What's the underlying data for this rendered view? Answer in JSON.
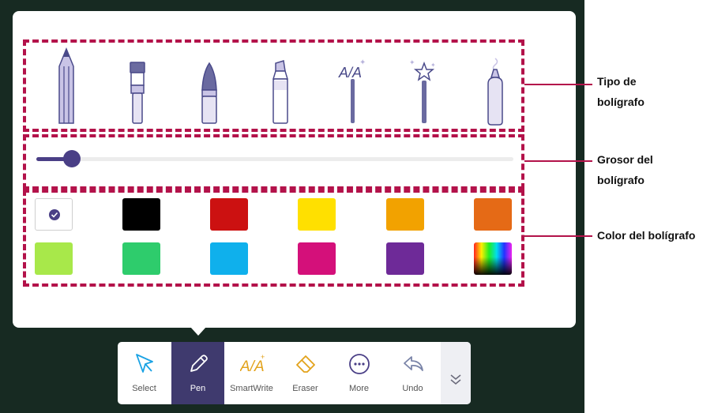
{
  "pen_types": [
    {
      "icon": "pencil-icon"
    },
    {
      "icon": "brush-icon"
    },
    {
      "icon": "fountain-pen-icon"
    },
    {
      "icon": "highlighter-icon"
    },
    {
      "icon": "smartwrite-pen-icon"
    },
    {
      "icon": "magic-wand-icon"
    },
    {
      "icon": "spray-pen-icon"
    }
  ],
  "thickness": {
    "value_fraction": 0.08
  },
  "colors": {
    "selected": "#ffffff",
    "swatches": [
      "#ffffff",
      "#000000",
      "#cc1111",
      "#ffe000",
      "#f2a200",
      "#e56a16",
      "#a8e84a",
      "#2ecc6c",
      "#0fb0ec",
      "#d4107a",
      "#6e2a98",
      "spectrum"
    ]
  },
  "annotations": {
    "tipo_line1": "Tipo de",
    "tipo_line2": "bolígrafo",
    "grosor_line1": "Grosor del",
    "grosor_line2": "bolígrafo",
    "color": "Color del bolígrafo"
  },
  "toolbar": {
    "select": "Select",
    "pen": "Pen",
    "smartwrite": "SmartWrite",
    "eraser": "Eraser",
    "more": "More",
    "undo": "Undo",
    "accent": "#3f3a6e"
  }
}
